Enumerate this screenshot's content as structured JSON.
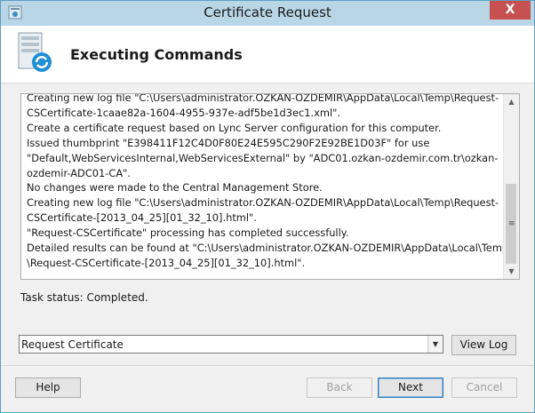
{
  "window": {
    "title": "Certificate Request",
    "close_glyph": "X"
  },
  "header": {
    "title": "Executing Commands"
  },
  "log": {
    "lines": [
      "Creating new log file \"C:\\Users\\administrator.OZKAN-OZDEMIR\\AppData\\Local\\Temp\\Request-",
      "CSCertificate-1caae82a-1604-4955-937e-adf5be1d3ec1.xml\".",
      "Create a certificate request based on Lync Server configuration for this computer.",
      "Issued thumbprint \"E398411F12C4D0F80E24E595C290F2E92BE1D03F\" for use",
      "\"Default,WebServicesInternal,WebServicesExternal\" by \"ADC01.ozkan-ozdemir.com.tr\\ozkan-",
      "ozdemir-ADC01-CA\".",
      "No changes were made to the Central Management Store.",
      "Creating new log file \"C:\\Users\\administrator.OZKAN-OZDEMIR\\AppData\\Local\\Temp\\Request-",
      "CSCertificate-[2013_04_25][01_32_10].html\".",
      "\"Request-CSCertificate\" processing has completed successfully.",
      "Detailed results can be found at \"C:\\Users\\administrator.OZKAN-OZDEMIR\\AppData\\Local\\Temp",
      "\\Request-CSCertificate-[2013_04_25][01_32_10].html\"."
    ]
  },
  "status": {
    "text": "Task status: Completed."
  },
  "task_select": {
    "value": "Request Certificate"
  },
  "buttons": {
    "view_log": "View Log",
    "help": "Help",
    "back": "Back",
    "next": "Next",
    "cancel": "Cancel"
  },
  "icons": {
    "app": "certificate-app-icon",
    "header": "server-refresh-icon",
    "scroll_up": "chevron-up-icon",
    "scroll_down": "chevron-down-icon",
    "combo_arrow": "dropdown-arrow-icon"
  },
  "colors": {
    "titlebar": "#b9d6e6",
    "close": "#c75050",
    "border": "#5a9fbf"
  }
}
